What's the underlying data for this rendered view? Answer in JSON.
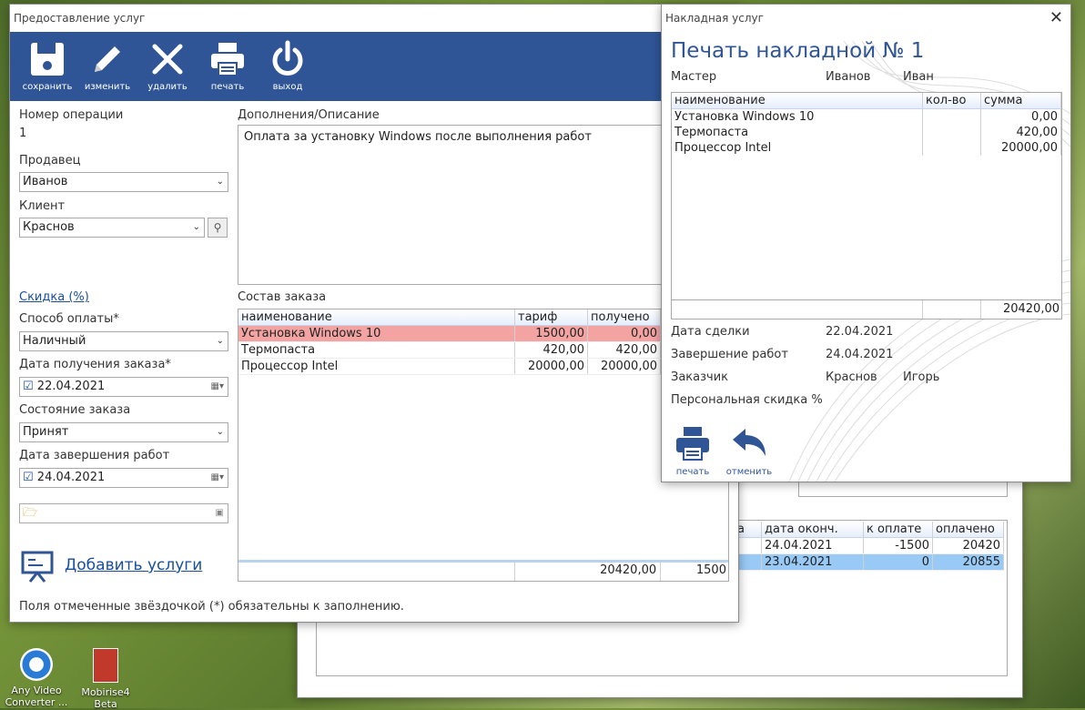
{
  "desktop": {
    "icons": [
      {
        "label_line1": "Any Video",
        "label_line2": "Converter ..."
      },
      {
        "label_line1": "Mobirise4",
        "label_line2": "Beta"
      }
    ]
  },
  "main_window": {
    "title": "Предоставление услуг",
    "toolbar": {
      "save": "сохранить",
      "edit": "изменить",
      "delete": "удалить",
      "print": "печать",
      "exit": "выход"
    },
    "op_number_label": "Номер операции",
    "op_number": "1",
    "seller_label": "Продавец",
    "seller": "Иванов",
    "client_label": "Клиент",
    "client": "Краснов",
    "discount_link": "Скидка (%)",
    "payment_label": "Способ оплаты*",
    "payment": "Наличный",
    "order_date_label": "Дата получения заказа*",
    "order_date": "22.04.2021",
    "state_label": "Состояние заказа",
    "state": "Принят",
    "finish_date_label": "Дата завершения работ",
    "finish_date": "24.04.2021",
    "add_services": "Добавить услуги",
    "required_note": "Поля отмеченные звёздочкой (*) обязательны к заполнению.",
    "description_label": "Дополнения/Описание",
    "description": "Оплата за установку Windows после выполнения работ",
    "order_label": "Состав заказа",
    "order_columns": [
      "наименование",
      "тариф",
      "получено"
    ],
    "order_rows": [
      {
        "name": "Установка Windows 10",
        "tariff": "1500,00",
        "received": "0,00"
      },
      {
        "name": "Термопаста",
        "tariff": "420,00",
        "received": "420,00"
      },
      {
        "name": "Процессор Intel",
        "tariff": "20000,00",
        "received": "20000,00"
      }
    ],
    "order_total_tariff": "20420,00",
    "order_total_received": "1500"
  },
  "back_window": {
    "columns": [
      "а",
      "дата оконч.",
      "к оплате",
      "оплачено"
    ],
    "rows": [
      {
        "a": "",
        "date": "24.04.2021",
        "topay": "-1500",
        "paid": "20420"
      },
      {
        "a": "",
        "date": "23.04.2021",
        "topay": "0",
        "paid": "20855"
      }
    ]
  },
  "invoice_window": {
    "title": "Накладная услуг",
    "heading": "Печать накладной № 1",
    "master_label": "Мастер",
    "master_last": "Иванов",
    "master_first": "Иван",
    "columns": [
      "наименование",
      "кол-во",
      "сумма"
    ],
    "rows": [
      {
        "name": "Установка Windows 10",
        "qty": "",
        "sum": "0,00"
      },
      {
        "name": "Термопаста",
        "qty": "",
        "sum": "420,00"
      },
      {
        "name": "Процессор Intel",
        "qty": "",
        "sum": "20000,00"
      }
    ],
    "total": "20420,00",
    "deal_date_label": "Дата сделки",
    "deal_date": "22.04.2021",
    "finish_label": "Завершение работ",
    "finish_date": "24.04.2021",
    "customer_label": "Заказчик",
    "customer_last": "Краснов",
    "customer_first": "Игорь",
    "discount_label": "Персональная скидка %",
    "print_btn": "печать",
    "cancel_btn": "отменить"
  }
}
